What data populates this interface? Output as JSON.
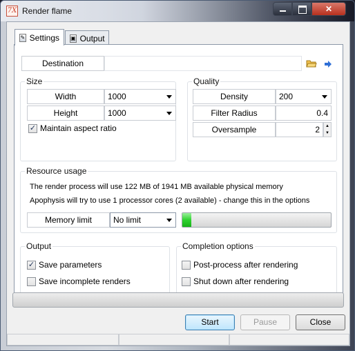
{
  "window": {
    "title": "Render flame"
  },
  "tabs": [
    {
      "label": "Settings",
      "active": true
    },
    {
      "label": "Output",
      "active": false
    }
  ],
  "destination": {
    "label": "Destination",
    "value": ""
  },
  "size": {
    "group_label": "Size",
    "width_label": "Width",
    "width_value": "1000",
    "height_label": "Height",
    "height_value": "1000",
    "maintain_aspect_label": "Maintain aspect ratio",
    "maintain_aspect_checked": true
  },
  "quality": {
    "group_label": "Quality",
    "density_label": "Density",
    "density_value": "200",
    "filter_radius_label": "Filter Radius",
    "filter_radius_value": "0.4",
    "oversample_label": "Oversample",
    "oversample_value": "2"
  },
  "resource": {
    "group_label": "Resource usage",
    "memory_text": "The render process will use 122 MB of 1941 MB available physical memory",
    "cores_text": "Apophysis will try to use 1 processor cores (2 available) - change this in the options",
    "memory_limit_label": "Memory limit",
    "memory_limit_value": "No limit",
    "memory_usage_fraction": 0.06
  },
  "output": {
    "group_label": "Output",
    "save_parameters_label": "Save parameters",
    "save_parameters_checked": true,
    "save_incomplete_label": "Save incomplete renders",
    "save_incomplete_checked": false
  },
  "completion": {
    "group_label": "Completion options",
    "post_process_label": "Post-process after rendering",
    "post_process_checked": false,
    "shutdown_label": "Shut down after rendering",
    "shutdown_checked": false
  },
  "buttons": {
    "start": "Start",
    "pause": "Pause",
    "close": "Close"
  },
  "render_progress_fraction": 0,
  "colors": {
    "accent_green": "#2fd22f",
    "default_button": "#bee6fd"
  }
}
